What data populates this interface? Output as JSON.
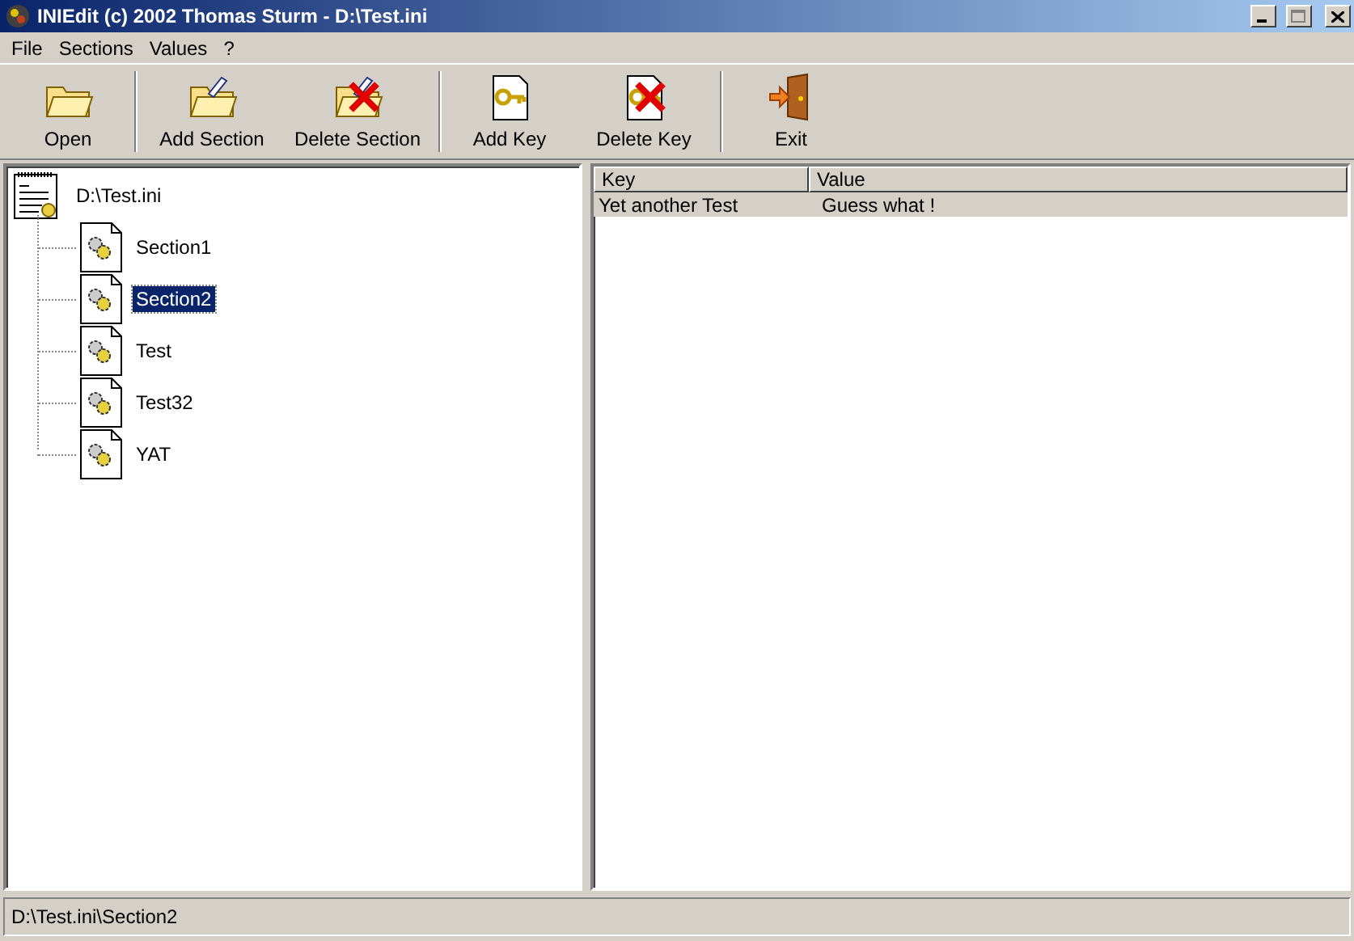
{
  "window": {
    "title": "INIEdit (c) 2002 Thomas Sturm - D:\\Test.ini"
  },
  "menu": [
    {
      "label": "File"
    },
    {
      "label": "Sections"
    },
    {
      "label": "Values"
    },
    {
      "label": "?"
    }
  ],
  "toolbar": [
    {
      "label": "Open",
      "kind": "open",
      "group_end": true
    },
    {
      "label": "Add Section",
      "kind": "add-section",
      "group_end": false
    },
    {
      "label": "Delete Section",
      "kind": "delete-section",
      "group_end": true
    },
    {
      "label": "Add Key",
      "kind": "add-key",
      "group_end": false
    },
    {
      "label": "Delete Key",
      "kind": "delete-key",
      "group_end": true
    },
    {
      "label": "Exit",
      "kind": "exit",
      "group_end": false
    }
  ],
  "tree": {
    "label": "D:\\Test.ini",
    "selected": false,
    "children": [
      {
        "label": "Section1",
        "selected": false
      },
      {
        "label": "Section2",
        "selected": true
      },
      {
        "label": "Test",
        "selected": false
      },
      {
        "label": "Test32",
        "selected": false
      },
      {
        "label": "YAT",
        "selected": false
      }
    ]
  },
  "table": {
    "columns": [
      "Key",
      "Value"
    ],
    "rows": [
      {
        "cells": [
          "Yet another Test",
          "Guess what !"
        ],
        "selected": true
      }
    ]
  },
  "status_bar": "D:\\Test.ini\\Section2"
}
